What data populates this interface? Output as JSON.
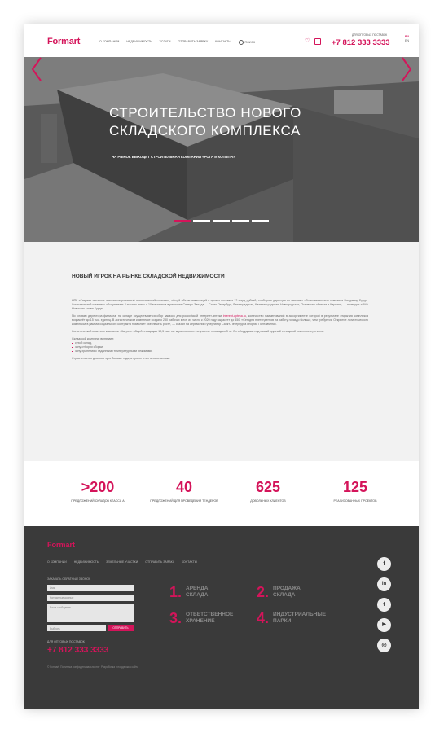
{
  "header": {
    "logo": "Formart",
    "nav": [
      "О компании",
      "Недвижимость",
      "Услуги",
      "Отправить заявку",
      "Контакты",
      "Поиск"
    ],
    "phone_caption": "Для оптовых поставок",
    "phone": "+7 812 333 3333",
    "lang": [
      "RU",
      "EN"
    ]
  },
  "hero": {
    "title": "СТРОИТЕЛЬСТВО НОВОГО СКЛАДСКОГО КОМПЛЕКСА",
    "subtitle": "На рынок выходит строительная компания «Рога и копыта»",
    "slides": 5,
    "active_slide": 1
  },
  "article": {
    "title": "НОВЫЙ ИГРОК НА РЫНКЕ СКЛАДСКОЙ НЕДВИЖИМОСТИ",
    "p1": "НПК «Катрен» построит автоматизированный логистический комплекс, общий объем инвестиций в проект составит 12 млрд рублей, сообщила дирекция по связям с общественностью компании Владимир Бурда. Логистический комплекс обслуживает 2 тысячи аптек и 10 магазинов в регионах Северо-Запада — Санкт-Петербург, Ленинградская, Калининградская, Новгородская, Псковская области и Карелия, — приводит «РИА Новости» слова Бурды.",
    "p2_pre": "По словам директора филиала, на складе осуществляется сбор заказов для российской интернет-аптеки ",
    "p2_link": "interent-apteka.ru",
    "p2_post": ", количество наименований в ассортименте которой в результате открытия комплекса возрастёт до 15 тыс. единиц. В логистическом комплексе создано 230 рабочих мест, их число к 2020 году вырастет до 450. «Сегодня претендентов на работу гораздо больше, чем требуется. Открытие логистического комплекса в рамках социального контракта позволяет обеспечить рост», — сказал на церемонии губернатор Санкт-Петербурга Георгий Полтавченко.",
    "p3": "Логистический комплекс компании «Катрен» общей площадью 10,5 тыс. кв. м расположен на участке площадью 3 га. Он оборудован под самый крупный складской комплекс в регионе.",
    "list_intro": "Складской комплекс включает:",
    "list": [
      "сухой склад,",
      "зону отборки сборки,",
      "зону хранения с заданными температурными режимами."
    ],
    "p4": "Строительство длилось чуть больше года, а проект стал многоэтапным."
  },
  "stats": [
    {
      "value": ">200",
      "label": "Предложений складов класса А"
    },
    {
      "value": "40",
      "label": "Предложений для проведения тендеров"
    },
    {
      "value": "625",
      "label": "Довольных клиентов"
    },
    {
      "value": "125",
      "label": "Реализованных проектов"
    }
  ],
  "footer": {
    "logo": "Formart",
    "nav": [
      "О компании",
      "Недвижимость",
      "Земельные участки",
      "Отправить заявку",
      "Контакты"
    ],
    "form_caption": "Заказать обратный звонок",
    "field_name": "Имя",
    "field_contact": "Контактные данные",
    "field_message": "Ваше сообщение",
    "field_file": "Выбрать",
    "submit": "Отправить",
    "phone_caption": "Для оптовых поставок",
    "phone": "+7 812 333 3333",
    "copyright": "© Formart. Политика конфиденциальности · Разработка и поддержка сайта",
    "services": [
      {
        "num": "1.",
        "label": "Аренда склада"
      },
      {
        "num": "2.",
        "label": "Продажа склада"
      },
      {
        "num": "3.",
        "label": "Ответственное хранение"
      },
      {
        "num": "4.",
        "label": "Индустриальные парки"
      }
    ],
    "social": [
      "f",
      "in",
      "t",
      "▶",
      "◎"
    ]
  },
  "colors": {
    "accent": "#d4145a",
    "footer_bg": "#3a3a3a",
    "article_bg": "#f2f2f2"
  }
}
